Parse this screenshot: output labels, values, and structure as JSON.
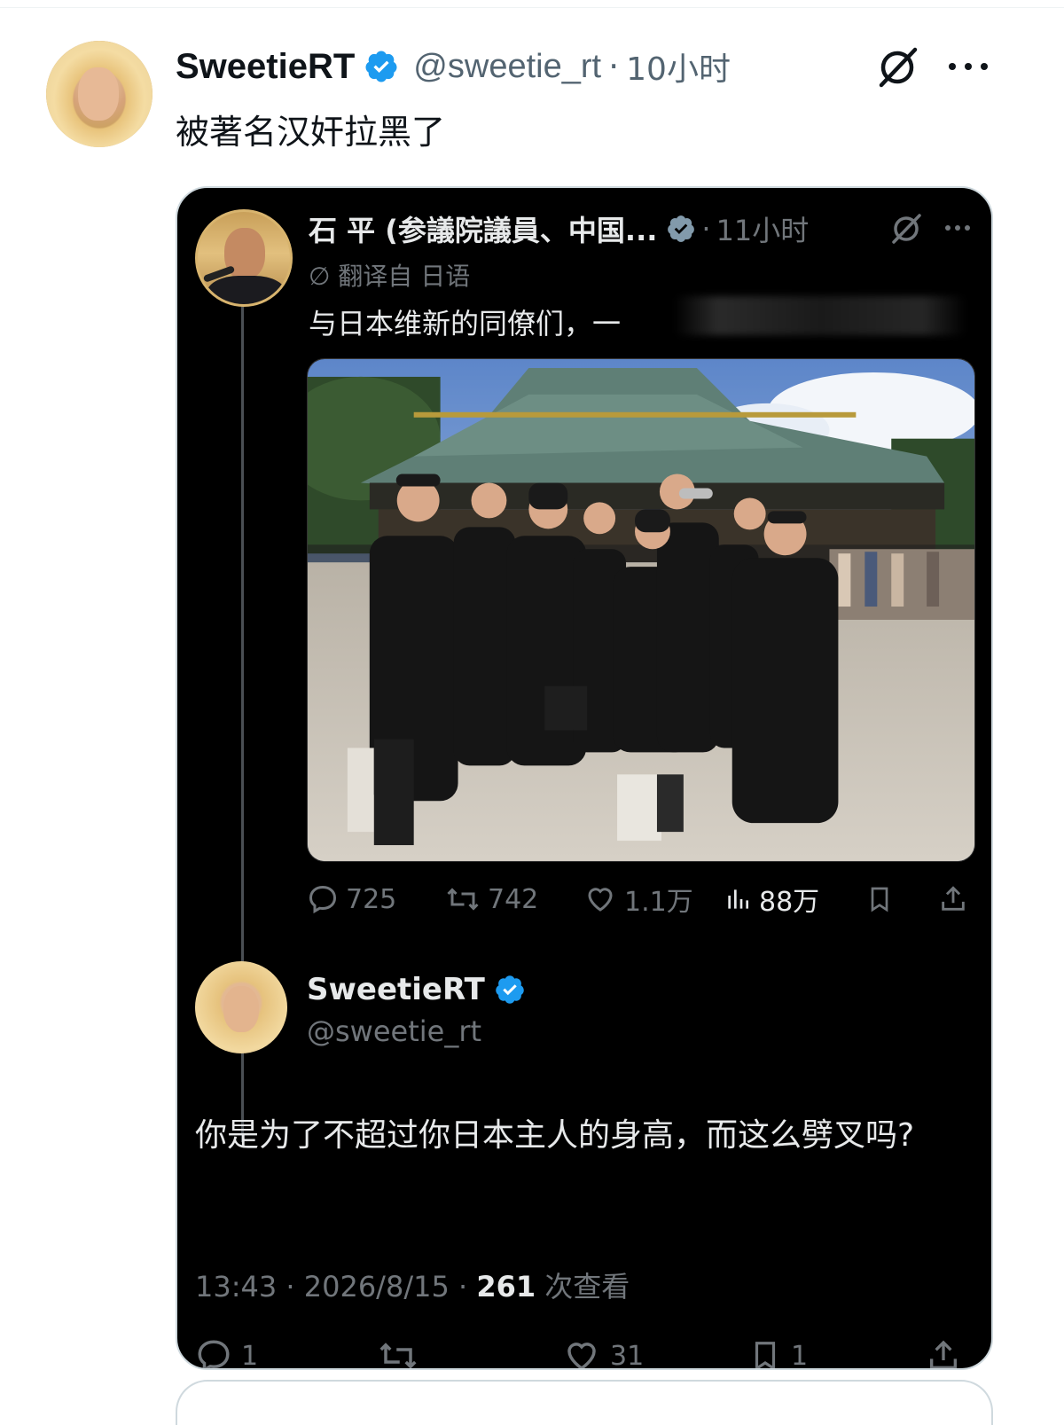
{
  "tweet": {
    "author_name": "SweetieRT",
    "handle": "@sweetie_rt",
    "separator": "·",
    "time": "10小时",
    "text": "被著名汉奸拉黑了",
    "avatar_icon": "woman-portrait-avatar",
    "verified_color": "#1d9bf0"
  },
  "embedded": {
    "quoted": {
      "author_name": "石 平 (参議院議員、中国...",
      "separator": "·",
      "time": "11小时",
      "translated_label": "翻译自 日语",
      "translated_icon": "∅",
      "text": "与日本维新的同僚们，一",
      "photo_icon": "shrine-group-photo",
      "stats": {
        "replies": "725",
        "reposts": "742",
        "likes": "1.1万",
        "views": "88万"
      }
    },
    "reply": {
      "author_name": "SweetieRT",
      "handle": "@sweetie_rt",
      "text": "你是为了不超过你日本主人的身高，而这么劈叉吗?",
      "timestamp": "13:43 · 2026/8/15 · ",
      "views_count": "261",
      "views_label": " 次查看",
      "stats": {
        "replies": "1",
        "likes": "31",
        "bookmarks": "1"
      }
    }
  }
}
